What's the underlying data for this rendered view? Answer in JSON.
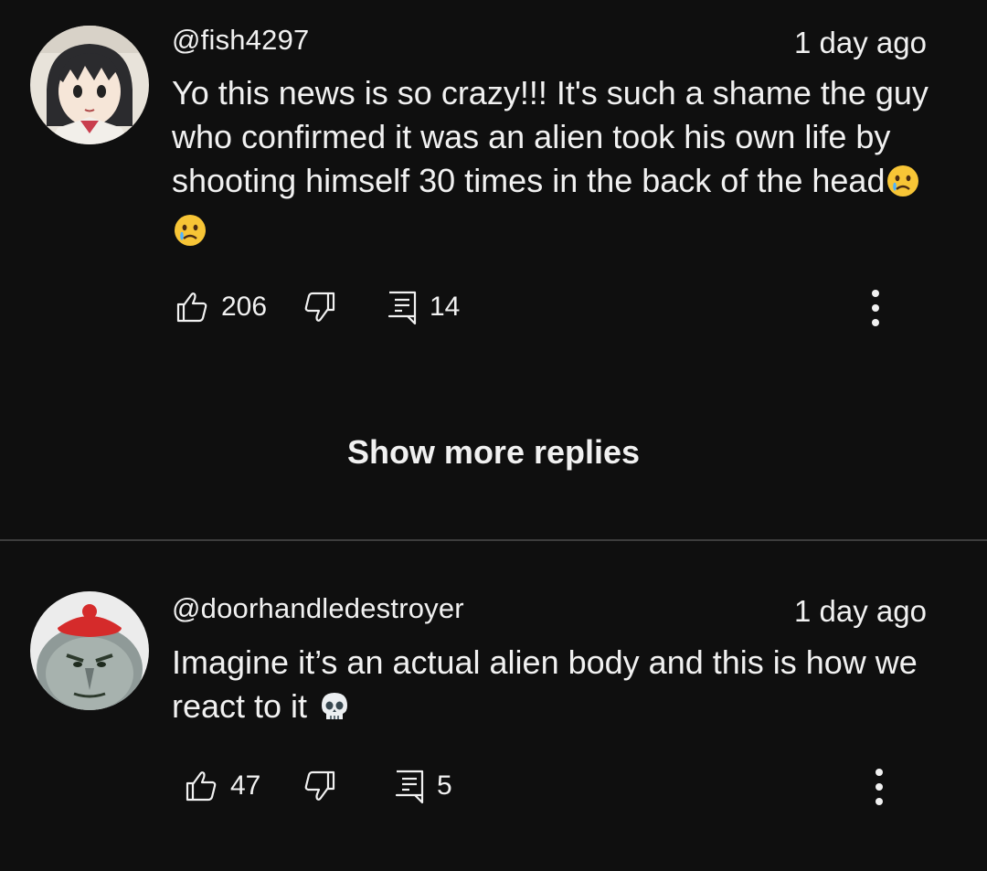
{
  "comments": [
    {
      "author": "@fish4297",
      "time": "1 day ago",
      "text": "Yo this news is so crazy!!! It's such a shame the guy who confirmed it was an alien took his own life by shooting himself 30 times in the back of the head",
      "emojis": [
        "crying-face-emoji",
        "crying-face-emoji"
      ],
      "likes": "206",
      "replies": "14"
    },
    {
      "author": "@doorhandledestroyer",
      "time": "1 day ago",
      "text": "Imagine it’s an actual alien body and this is how we react to it",
      "emojis": [
        "skull-emoji"
      ],
      "likes": "47",
      "replies": "5"
    }
  ],
  "show_more_label": "Show more replies",
  "colors": {
    "background": "#0f0f0f",
    "text": "#f1f1f1",
    "divider": "#3d3d3d"
  }
}
